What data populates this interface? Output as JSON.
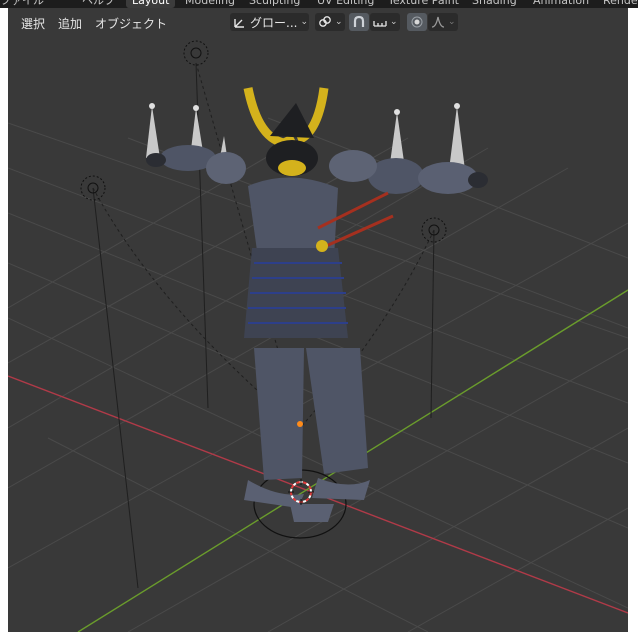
{
  "workspace_tabs": [
    "ファイル",
    "ヘルプ",
    "Layout",
    "Modeling",
    "Sculpting",
    "UV Editing",
    "Texture Paint",
    "Shading",
    "Animation",
    "Rendering"
  ],
  "active_tab": "Layout",
  "header": {
    "menu": [
      "選択",
      "追加",
      "オブジェクト"
    ],
    "transform_orientation": "グロー...",
    "chevron": "⌄"
  },
  "colors": {
    "viewport_bg": "#393939",
    "grid_line": "#4a4a4a",
    "x_axis": "#b03a48",
    "y_axis": "#6a9c2c",
    "cone": "#c9c9c9",
    "armor": "#4f5566",
    "helmet": "#1e1f22",
    "horn": "#d4b21c",
    "lace": "#2d3f8a",
    "cursor_red": "#e23b3b"
  },
  "icons": {
    "transform_orientation": "orientation-gizmo-icon",
    "pivot": "link-icon",
    "snap": "magnet-icon",
    "snap_increment": "snap-increment-icon",
    "proportional": "proportional-edit-icon",
    "falloff": "falloff-curve-icon"
  }
}
